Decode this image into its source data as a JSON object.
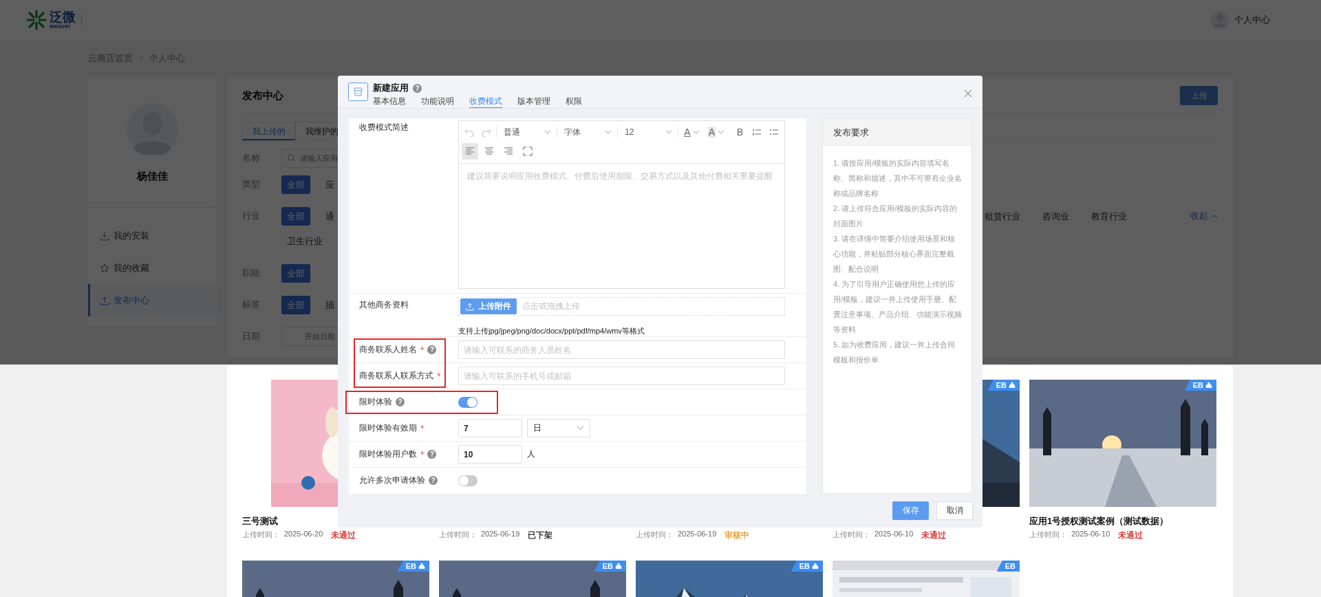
{
  "header": {
    "logo_text": "泛微",
    "logo_sub": "weaver",
    "user_label": "个人中心"
  },
  "breadcrumb": [
    "云商店首页",
    "个人中心"
  ],
  "profile": {
    "name": "杨佳佳"
  },
  "menu": [
    {
      "label": "我的安装",
      "kind": "download",
      "selected": false
    },
    {
      "label": "我的收藏",
      "kind": "star",
      "selected": false
    },
    {
      "label": "发布中心",
      "kind": "upload",
      "selected": true
    }
  ],
  "publish": {
    "title": "发布中心",
    "upload_button": "上传",
    "tabs": [
      {
        "label": "我上传的",
        "selected": true
      },
      {
        "label": "我维护的",
        "selected": false
      }
    ],
    "filters": [
      {
        "label": "名称",
        "kind": "search",
        "placeholder": "请输入应用"
      },
      {
        "label": "类型",
        "kind": "options",
        "options": [
          {
            "label": "全部",
            "selected": true
          },
          {
            "label": "应",
            "selected": false
          }
        ]
      },
      {
        "label": "行业",
        "kind": "options",
        "options": [
          {
            "label": "全部",
            "selected": true
          },
          {
            "label": "通",
            "selected": false
          }
        ],
        "right_options": [
          "租赁行业",
          "咨询业",
          "教育行业"
        ],
        "collapse": "收起",
        "wrap_options": [
          "卫生行业"
        ]
      },
      {
        "label": "职能",
        "kind": "options",
        "options": [
          {
            "label": "全部",
            "selected": true
          }
        ]
      },
      {
        "label": "标签",
        "kind": "options",
        "options": [
          {
            "label": "全部",
            "selected": true
          },
          {
            "label": "插",
            "selected": false
          }
        ]
      },
      {
        "label": "日期",
        "kind": "date",
        "placeholder": "开始日期"
      }
    ]
  },
  "cards": [
    {
      "kind": "picture",
      "title": "三号测试",
      "time_label": "上传时间：",
      "date": "2025-06-20",
      "status": {
        "label": "未通过",
        "color": "#e03a3a"
      }
    },
    {
      "time_label": "上传时间：",
      "date": "2025-06-19",
      "status": {
        "label": "已下架",
        "color": "#333333"
      }
    },
    {
      "time_label": "上传时间：",
      "date": "2025-06-19",
      "status": {
        "label": "审核中",
        "color": "#e8a33a"
      }
    },
    {
      "kind": "picture",
      "badge": {
        "label": "EB",
        "paid": true
      },
      "time_label": "上传时间：",
      "date": "2025-06-10",
      "status": {
        "label": "未通过",
        "color": "#e03a3a"
      }
    },
    {
      "kind": "picture",
      "badge": {
        "label": "EB",
        "paid": true
      },
      "title": "应用1号授权测试案例（测试数据）",
      "time_label": "上传时间：",
      "date": "2025-06-10",
      "status": {
        "label": "未通过",
        "color": "#e03a3a"
      }
    },
    {
      "kind": "picture",
      "badge": {
        "label": "EB",
        "paid": true
      }
    },
    {
      "kind": "picture",
      "badge": {
        "label": "EB",
        "paid": true
      }
    },
    {
      "kind": "picture",
      "badge": {
        "label": "EB",
        "paid": true
      }
    },
    {
      "kind": "picture",
      "badge": {
        "label": "EB",
        "paid": false
      }
    }
  ],
  "dialog": {
    "title": "新建应用",
    "help": "?",
    "tabs": [
      {
        "label": "基本信息",
        "selected": false
      },
      {
        "label": "功能说明",
        "selected": false
      },
      {
        "label": "收费模式",
        "selected": true
      },
      {
        "label": "版本管理",
        "selected": false
      },
      {
        "label": "权限",
        "selected": false
      }
    ],
    "form": [
      {
        "kind": "editor",
        "label": "收费模式简述",
        "placeholder": "建议简要说明应用收费模式、付费后使用期限、交易方式以及其他付费相关重要提醒",
        "toolbar_rows": [
          [
            {
              "kind": "undo"
            },
            {
              "kind": "redo"
            },
            {
              "kind": "select",
              "label": "普通"
            },
            {
              "kind": "select",
              "label": "字体"
            },
            {
              "kind": "select",
              "label": "12"
            },
            {
              "kind": "font-color",
              "label": "A"
            },
            {
              "kind": "bg-color",
              "label": "A"
            },
            {
              "kind": "bold",
              "label": "B"
            },
            {
              "kind": "ordered-list"
            },
            {
              "kind": "bullet-list"
            }
          ],
          [
            {
              "kind": "align-left",
              "selected": true
            },
            {
              "kind": "align-center",
              "selected": false
            },
            {
              "kind": "align-right",
              "selected": false
            },
            {
              "kind": "fullscreen"
            }
          ]
        ]
      },
      {
        "kind": "upload",
        "label": "其他商务资料",
        "button": "上传附件",
        "hint": "点击或拖拽上传",
        "note": "支持上传jpg/jpeg/png/doc/docx/ppt/pdf/mp4/wmv等格式"
      },
      {
        "kind": "text",
        "label": "商务联系人姓名",
        "required": "*",
        "help": "?",
        "placeholder": "请输入可联系的商务人员姓名",
        "label_highlighted": true
      },
      {
        "kind": "text",
        "label": "商务联系人联系方式",
        "required": "*",
        "placeholder": "请输入可联系的手机号或邮箱",
        "label_highlighted": true
      },
      {
        "kind": "switch",
        "label": "限时体验",
        "help": "?",
        "on": true,
        "row_highlighted": true
      },
      {
        "kind": "number-select",
        "label": "限时体验有效期",
        "required": "*",
        "value": "7",
        "select": "日"
      },
      {
        "kind": "number-unit",
        "label": "限时体验用户数",
        "required": "*",
        "help": "?",
        "value": "10",
        "unit": "人"
      },
      {
        "kind": "switch",
        "label": "允许多次申请体验",
        "help": "?",
        "on": false
      }
    ],
    "requirements": {
      "title": "发布要求",
      "items": [
        "1. 请按应用/模板的实际内容填写名称、简称和描述，其中不可带有企业名称或品牌名称",
        "2. 请上传符合应用/模板的实际内容的封面图片",
        "3. 请在详情中简要介绍使用场景和核心功能，并粘贴部分核心界面完整截图、配合说明",
        "4. 为了引导用户正确使用您上传的应用/模板，建议一并上传使用手册、配置注意事项、产品介绍、功能演示视频等资料",
        "5. 如为收费应用，建议一并上传合同模板和报价单"
      ]
    },
    "buttons": [
      {
        "label": "保存",
        "kind": "primary"
      },
      {
        "label": "取消",
        "kind": "default"
      }
    ]
  }
}
